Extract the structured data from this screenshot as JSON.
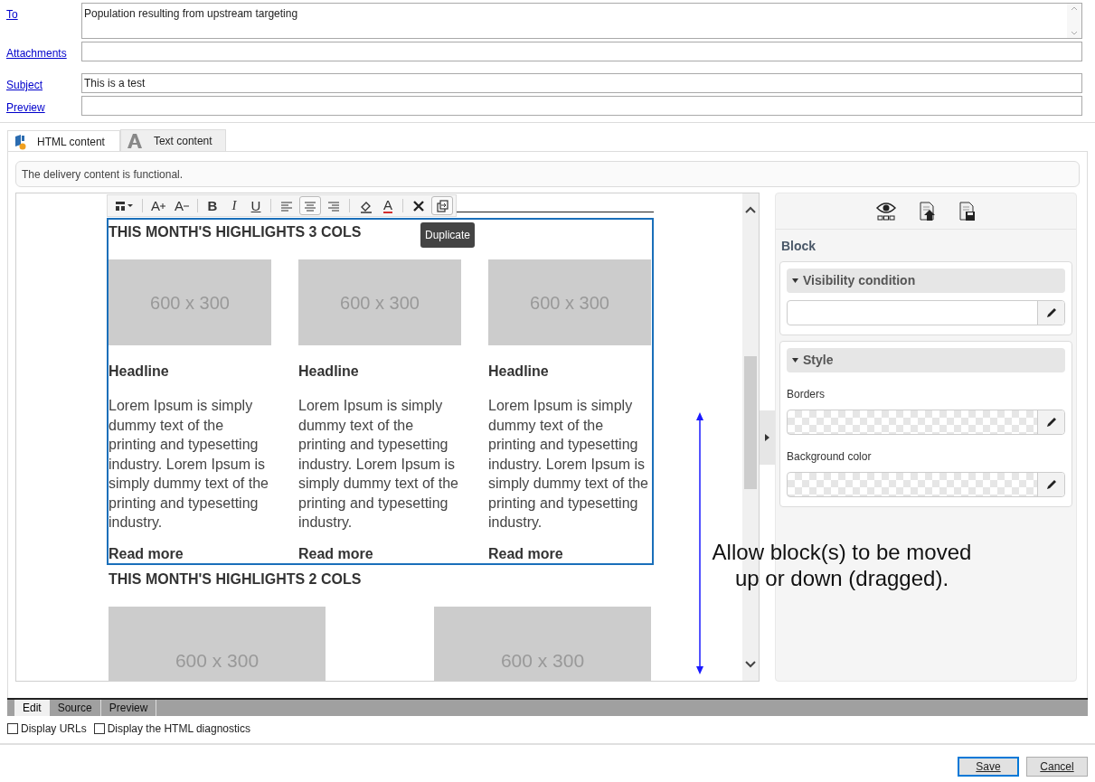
{
  "header_fields": [
    {
      "label": "To",
      "kind": "multiline",
      "value": "Population resulting from upstream targeting"
    },
    {
      "label": "Attachments",
      "kind": "single"
    },
    {
      "label": "Subject",
      "kind": "single",
      "value": "This is a test"
    },
    {
      "label": "Preview",
      "kind": "single"
    }
  ],
  "content_tabs": [
    {
      "label": "HTML content",
      "kind": "html",
      "selected": true
    },
    {
      "label": "Text content",
      "kind": "text",
      "selected": false
    }
  ],
  "status_message": "The delivery content is functional.",
  "toolbar": [
    {
      "kind": "layout",
      "selected": false
    },
    {
      "kind": "sep"
    },
    {
      "kind": "font-larger",
      "glyph": "A",
      "selected": false
    },
    {
      "kind": "font-smaller",
      "glyph": "A",
      "selected": false
    },
    {
      "kind": "sep"
    },
    {
      "kind": "bold",
      "glyph": "B",
      "selected": false
    },
    {
      "kind": "italic",
      "glyph": "I",
      "selected": false
    },
    {
      "kind": "underline",
      "glyph": "U",
      "selected": false
    },
    {
      "kind": "sep"
    },
    {
      "kind": "align-left",
      "selected": false
    },
    {
      "kind": "align-center",
      "selected": true
    },
    {
      "kind": "align-right",
      "selected": false
    },
    {
      "kind": "sep"
    },
    {
      "kind": "fill",
      "selected": false
    },
    {
      "kind": "text-color",
      "glyph": "A",
      "selected": false
    },
    {
      "kind": "sep"
    },
    {
      "kind": "delete",
      "selected": false
    },
    {
      "kind": "duplicate",
      "selected": true
    }
  ],
  "tooltip": "Duplicate",
  "blocks": [
    {
      "heading": "THIS MONTH'S HIGHLIGHTS 3 COLS",
      "selected": true,
      "columns": [
        {
          "image": "600 x 300",
          "headline": "Headline",
          "body": "Lorem Ipsum is simply dummy text of the printing and typesetting industry. Lorem Ipsum is simply dummy text of the printing and typesetting industry.",
          "link": "Read more"
        },
        {
          "image": "600 x 300",
          "headline": "Headline",
          "body": "Lorem Ipsum is simply dummy text of the printing and typesetting industry. Lorem Ipsum is simply dummy text of the printing and typesetting industry.",
          "link": "Read more"
        },
        {
          "image": "600 x 300",
          "headline": "Headline",
          "body": "Lorem Ipsum is simply dummy text of the printing and typesetting industry. Lorem Ipsum is simply dummy text of the printing and typesetting industry.",
          "link": "Read more"
        }
      ]
    },
    {
      "heading": "THIS MONTH'S HIGHLIGHTS 2 COLS",
      "selected": false,
      "columns": [
        {
          "image": "600 x 300"
        },
        {
          "image": "600 x 300"
        }
      ]
    }
  ],
  "annotation": "Allow block(s) to be moved up or down (dragged).",
  "panel": {
    "title": "Block",
    "sections": [
      {
        "title": "Visibility condition",
        "expanded": true,
        "fields": [
          {
            "kind": "text"
          }
        ]
      },
      {
        "title": "Style",
        "expanded": true,
        "fields": [
          {
            "label": "Borders",
            "kind": "color"
          },
          {
            "label": "Background color",
            "kind": "color"
          }
        ]
      }
    ]
  },
  "editor_tabs": [
    {
      "label": "Edit",
      "selected": true
    },
    {
      "label": "Source",
      "selected": false
    },
    {
      "label": "Preview",
      "selected": false
    }
  ],
  "options": [
    {
      "label": "Display URLs",
      "checked": false
    },
    {
      "label": "Display the HTML diagnostics",
      "checked": false
    }
  ],
  "buttons": [
    {
      "label": "Save",
      "kind": "primary"
    },
    {
      "label": "Cancel",
      "kind": "secondary"
    }
  ]
}
